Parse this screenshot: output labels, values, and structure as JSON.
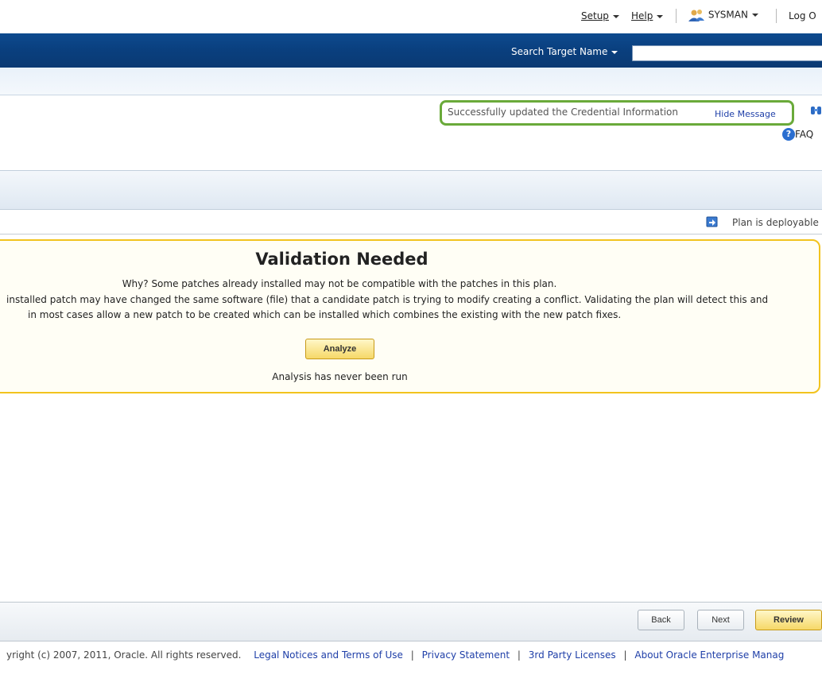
{
  "topbar": {
    "setup": "Setup",
    "help": "Help",
    "user": "SYSMAN",
    "logout": "Log O"
  },
  "header": {
    "search_label": "Search Target Name",
    "search_value": ""
  },
  "message": {
    "text": "Successfully updated the Credential Information",
    "hide": "Hide Message",
    "faq": "FAQ"
  },
  "plan_status": "Plan is deployable",
  "validation": {
    "title": "Validation Needed",
    "line1": "Why? Some patches already installed may not be compatible with the patches in this plan.",
    "line2": "installed patch may have changed the same software (file) that a candidate patch is trying to modify creating a conflict. Validating the plan will detect this and",
    "line3": "in most cases allow a new patch to be created which can be installed which combines the existing with the new patch fixes.",
    "analyze_button": "Analyze",
    "status": "Analysis has never been run"
  },
  "nav": {
    "back": "Back",
    "next": "Next",
    "review": "Review"
  },
  "footer": {
    "copyright": "yright (c) 2007, 2011, Oracle. All rights reserved.",
    "links": [
      "Legal Notices and Terms of Use",
      "Privacy Statement",
      "3rd Party Licenses",
      "About Oracle Enterprise Manag"
    ]
  },
  "colors": {
    "header_blue": "#0b3f7f",
    "message_border": "#6aaa3a",
    "validation_border": "#f2c31e",
    "link": "#1f3fa8"
  }
}
